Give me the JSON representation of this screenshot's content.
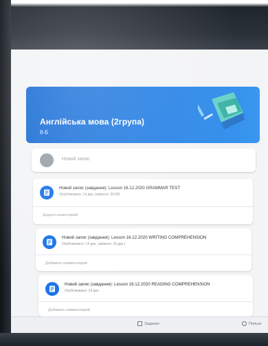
{
  "course": {
    "title": "Англійська мова (2група)",
    "section": "8-Б"
  },
  "post_box": {
    "placeholder": "Новий запис"
  },
  "stream": [
    {
      "title": "Новий запис (завдання): Lesson 16.12.2020 GRAMMAR TEST",
      "meta": "Опубліковано: 14 дек. (змінено: 20:00)",
      "comment": "Додати коментарий"
    },
    {
      "title": "Новий запис (завдання): Lesson 16.12.2020 WRITING COMPREHENSION",
      "meta": "Опубліковано: 14 дек. (змінено: 16 дек.)",
      "comment": "Добавить комментарий"
    },
    {
      "title": "Новий запис (завдання): Lesson 16.12.2020 READING COMPREHENSION",
      "meta": "Опубліковано: 14 дек.",
      "comment": "Добавить комментарий"
    }
  ],
  "nav": {
    "tasks": "Задания",
    "people": "Пользо"
  },
  "colors": {
    "accent": "#1a73e8",
    "banner": "#1d6fd6"
  },
  "icons": {
    "assignment": "assignment-icon",
    "avatar": "user-avatar-icon",
    "tasks": "tasks-icon",
    "people": "people-icon"
  }
}
